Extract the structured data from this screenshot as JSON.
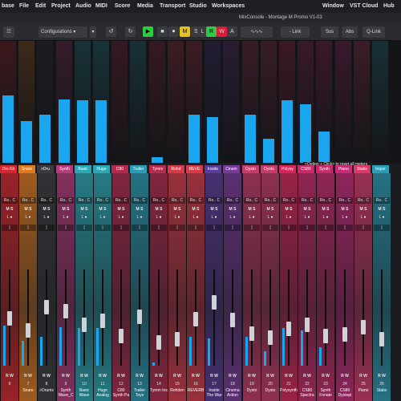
{
  "menubar": {
    "app": "base",
    "items": [
      "File",
      "Edit",
      "Project",
      "Audio",
      "MIDI",
      "Score",
      "Media",
      "Transport",
      "Studio",
      "Workspaces",
      "Window",
      "VST Cloud",
      "Hub"
    ]
  },
  "window_title": "MixConsole - Montage M Promo V1-03",
  "toolbar": {
    "configurations": "Configurations",
    "buttons": [
      "↺",
      "↻",
      "▶",
      "■",
      "⏺"
    ],
    "mode_buttons": [
      "M",
      "S",
      "L",
      "R",
      "W",
      "A"
    ],
    "link": "- Link",
    "right_buttons": [
      "Sus",
      "Abs",
      "Q-Link"
    ]
  },
  "meter_tooltip": "<Option + Click> to reset all meters",
  "colors": {
    "meter": "#19a6ef",
    "read": "#2ecc40",
    "record": "#e0183a"
  },
  "channels": [
    {
      "name": "Drs Kit",
      "color": "#d8262e",
      "level": "0.56",
      "number": "6",
      "bottom": "",
      "fader": "0.62"
    },
    {
      "name": "Snare",
      "color": "#e07a1f",
      "level": "0.35",
      "number": "7",
      "bottom": "Snare",
      "fader": "0.48"
    },
    {
      "name": ">Dru",
      "color": "#3a3c40",
      "level": "0.40",
      "number": "8",
      "bottom": ">Drums",
      "fader": "0.75"
    },
    {
      "name": "Synth",
      "color": "#b93a7c",
      "level": "0.53",
      "number": "9",
      "bottom": "Synth Wave_C",
      "fader": "0.70"
    },
    {
      "name": "Basic",
      "color": "#2aa9b5",
      "level": "0.52",
      "number": "10",
      "bottom": "Basic Wave",
      "fader": "0.55"
    },
    {
      "name": "Huge",
      "color": "#2aa9b5",
      "level": "0.52",
      "number": "11",
      "bottom": "Huge Analog",
      "fader": "0.59"
    },
    {
      "name": "C80",
      "color": "#b52a4f",
      "level": "0.00",
      "number": "12",
      "bottom": "C80 Synth Pa",
      "fader": "0.42"
    },
    {
      "name": "Trailer",
      "color": "#2a9cb5",
      "level": "0.00",
      "number": "13",
      "bottom": "Trailer Toys",
      "fader": "0.64"
    },
    {
      "name": "Tymm",
      "color": "#b52a4f",
      "level": "0.05",
      "number": "14",
      "bottom": "Tymm Ins",
      "fader": "0.35"
    },
    {
      "name": "Rohd",
      "color": "#d83a4a",
      "level": "0.00",
      "number": "15",
      "bottom": "Rohden",
      "fader": "0.38"
    },
    {
      "name": "REVE",
      "color": "#d83a4a",
      "level": "0.40",
      "number": "16",
      "bottom": "REVERB",
      "fader": "0.61"
    },
    {
      "name": "Inside",
      "color": "#5a3a9a",
      "level": "0.38",
      "number": "17",
      "bottom": "Inside The War",
      "fader": "0.80"
    },
    {
      "name": "Cinem",
      "color": "#7a3a9a",
      "level": "0.00",
      "number": "18",
      "bottom": "Cinema Action",
      "fader": "0.60"
    },
    {
      "name": "Dysto",
      "color": "#c83a6a",
      "level": "0.40",
      "number": "19",
      "bottom": "Dysto",
      "fader": "0.45"
    },
    {
      "name": "Dysto",
      "color": "#c83a6a",
      "level": "0.20",
      "number": "20",
      "bottom": "Dysto",
      "fader": "0.40"
    },
    {
      "name": "Polysy",
      "color": "#d8265a",
      "level": "0.52",
      "number": "21",
      "bottom": "Polysynth",
      "fader": "0.50"
    },
    {
      "name": "CS80",
      "color": "#c82a6a",
      "level": "0.49",
      "number": "22",
      "bottom": "CS80 Spectra",
      "fader": "0.55"
    },
    {
      "name": "Synth",
      "color": "#c82a6a",
      "level": "0.26",
      "number": "23",
      "bottom": "Synth Foriate",
      "fader": "0.42"
    },
    {
      "name": "Piano",
      "color": "#c82a7a",
      "level": "0.00",
      "number": "24",
      "bottom": "CS80 Dystopi",
      "fader": "0.44"
    },
    {
      "name": "Stabs",
      "color": "#d83a6a",
      "level": "0.00",
      "number": "25",
      "bottom": "Piano",
      "fader": "0.52"
    },
    {
      "name": "Imper",
      "color": "#2a9cb5",
      "level": "0.00",
      "number": "26",
      "bottom": "Stabs",
      "fader": "0.38"
    }
  ]
}
